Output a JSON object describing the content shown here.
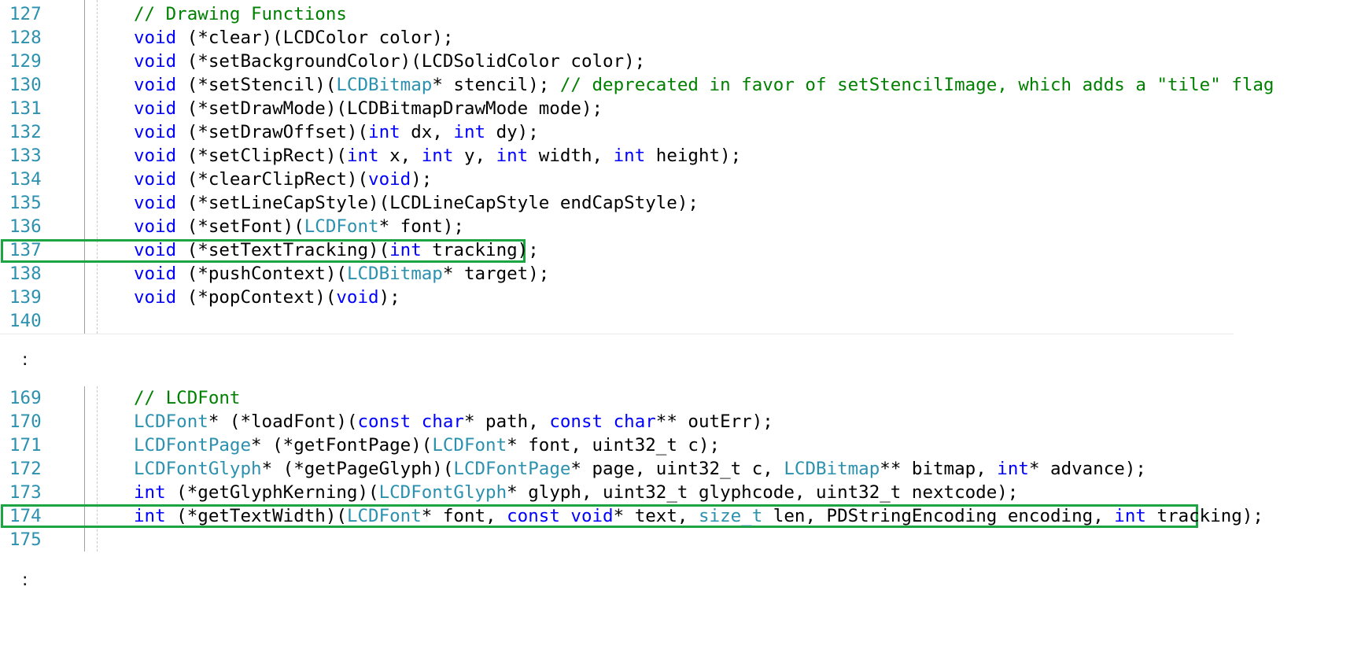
{
  "colors": {
    "keyword": "#0000ff",
    "type": "#2b91af",
    "comment": "#008000",
    "line_number": "#2b91af",
    "highlight_box": "#1ea543"
  },
  "ellipsis_symbol": ":",
  "blocks": [
    {
      "id": "block-1",
      "highlighted_line": "137",
      "lines": [
        {
          "num": "127",
          "tokens": [
            [
              "cm",
              "// Drawing Functions"
            ]
          ]
        },
        {
          "num": "128",
          "tokens": [
            [
              "kw",
              "void"
            ],
            [
              "pl",
              " (*clear)(LCDColor color);"
            ]
          ]
        },
        {
          "num": "129",
          "tokens": [
            [
              "kw",
              "void"
            ],
            [
              "pl",
              " (*setBackgroundColor)(LCDSolidColor color);"
            ]
          ]
        },
        {
          "num": "130",
          "tokens": [
            [
              "kw",
              "void"
            ],
            [
              "pl",
              " (*setStencil)("
            ],
            [
              "ty",
              "LCDBitmap"
            ],
            [
              "pl",
              "* stencil); "
            ],
            [
              "cm",
              "// deprecated in favor of setStencilImage, which adds a \"tile\" flag"
            ]
          ]
        },
        {
          "num": "131",
          "tokens": [
            [
              "kw",
              "void"
            ],
            [
              "pl",
              " (*setDrawMode)(LCDBitmapDrawMode mode);"
            ]
          ]
        },
        {
          "num": "132",
          "tokens": [
            [
              "kw",
              "void"
            ],
            [
              "pl",
              " (*setDrawOffset)("
            ],
            [
              "kw",
              "int"
            ],
            [
              "pl",
              " dx, "
            ],
            [
              "kw",
              "int"
            ],
            [
              "pl",
              " dy);"
            ]
          ]
        },
        {
          "num": "133",
          "tokens": [
            [
              "kw",
              "void"
            ],
            [
              "pl",
              " (*setClipRect)("
            ],
            [
              "kw",
              "int"
            ],
            [
              "pl",
              " x, "
            ],
            [
              "kw",
              "int"
            ],
            [
              "pl",
              " y, "
            ],
            [
              "kw",
              "int"
            ],
            [
              "pl",
              " width, "
            ],
            [
              "kw",
              "int"
            ],
            [
              "pl",
              " height);"
            ]
          ]
        },
        {
          "num": "134",
          "tokens": [
            [
              "kw",
              "void"
            ],
            [
              "pl",
              " (*clearClipRect)("
            ],
            [
              "kw",
              "void"
            ],
            [
              "pl",
              ");"
            ]
          ]
        },
        {
          "num": "135",
          "tokens": [
            [
              "kw",
              "void"
            ],
            [
              "pl",
              " (*setLineCapStyle)(LCDLineCapStyle endCapStyle);"
            ]
          ]
        },
        {
          "num": "136",
          "tokens": [
            [
              "kw",
              "void"
            ],
            [
              "pl",
              " (*setFont)("
            ],
            [
              "ty",
              "LCDFont"
            ],
            [
              "pl",
              "* font);"
            ]
          ]
        },
        {
          "num": "137",
          "tokens": [
            [
              "kw",
              "void"
            ],
            [
              "pl",
              " (*setTextTracking)("
            ],
            [
              "kw",
              "int"
            ],
            [
              "pl",
              " tracking);"
            ]
          ]
        },
        {
          "num": "138",
          "tokens": [
            [
              "kw",
              "void"
            ],
            [
              "pl",
              " (*pushContext)("
            ],
            [
              "ty",
              "LCDBitmap"
            ],
            [
              "pl",
              "* target);"
            ]
          ]
        },
        {
          "num": "139",
          "tokens": [
            [
              "kw",
              "void"
            ],
            [
              "pl",
              " (*popContext)("
            ],
            [
              "kw",
              "void"
            ],
            [
              "pl",
              ");"
            ]
          ]
        },
        {
          "num": "140",
          "tokens": []
        }
      ]
    },
    {
      "id": "block-2",
      "highlighted_line": "174",
      "lines": [
        {
          "num": "169",
          "tokens": [
            [
              "cm",
              "// LCDFont"
            ]
          ]
        },
        {
          "num": "170",
          "tokens": [
            [
              "ty",
              "LCDFont"
            ],
            [
              "pl",
              "* (*loadFont)("
            ],
            [
              "kw",
              "const"
            ],
            [
              "pl",
              " "
            ],
            [
              "kw",
              "char"
            ],
            [
              "pl",
              "* path, "
            ],
            [
              "kw",
              "const"
            ],
            [
              "pl",
              " "
            ],
            [
              "kw",
              "char"
            ],
            [
              "pl",
              "** outErr);"
            ]
          ]
        },
        {
          "num": "171",
          "tokens": [
            [
              "ty",
              "LCDFontPage"
            ],
            [
              "pl",
              "* (*getFontPage)("
            ],
            [
              "ty",
              "LCDFont"
            ],
            [
              "pl",
              "* font, uint32_t c);"
            ]
          ]
        },
        {
          "num": "172",
          "tokens": [
            [
              "ty",
              "LCDFontGlyph"
            ],
            [
              "pl",
              "* (*getPageGlyph)("
            ],
            [
              "ty",
              "LCDFontPage"
            ],
            [
              "pl",
              "* page, uint32_t c, "
            ],
            [
              "ty",
              "LCDBitmap"
            ],
            [
              "pl",
              "** bitmap, "
            ],
            [
              "kw",
              "int"
            ],
            [
              "pl",
              "* advance);"
            ]
          ]
        },
        {
          "num": "173",
          "tokens": [
            [
              "kw",
              "int"
            ],
            [
              "pl",
              " (*getGlyphKerning)("
            ],
            [
              "ty",
              "LCDFontGlyph"
            ],
            [
              "pl",
              "* glyph, uint32_t glyphcode, uint32_t nextcode);"
            ]
          ]
        },
        {
          "num": "174",
          "tokens": [
            [
              "kw",
              "int"
            ],
            [
              "pl",
              " (*getTextWidth)("
            ],
            [
              "ty",
              "LCDFont"
            ],
            [
              "pl",
              "* font, "
            ],
            [
              "kw",
              "const"
            ],
            [
              "pl",
              " "
            ],
            [
              "kw",
              "void"
            ],
            [
              "pl",
              "* text, "
            ],
            [
              "ty",
              "size_t"
            ],
            [
              "pl",
              " len, PDStringEncoding encoding, "
            ],
            [
              "kw",
              "int"
            ],
            [
              "pl",
              " tracking);"
            ]
          ]
        },
        {
          "num": "175",
          "tokens": []
        }
      ]
    }
  ]
}
